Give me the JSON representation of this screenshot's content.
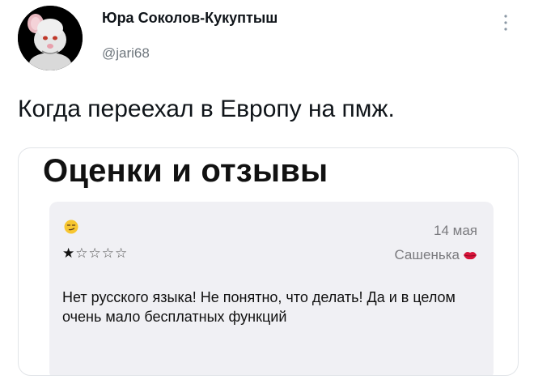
{
  "tweet": {
    "author_name": "Юра Соколов-Кукуптыш",
    "author_handle": "@jari68",
    "text": "Когда переехал в Европу на пмж."
  },
  "media": {
    "heading": "Оценки и отзывы",
    "review": {
      "emoji": "smirking-face-emoji",
      "date": "14 мая",
      "rating": 1,
      "max_rating": 5,
      "reviewer": "Сашенька",
      "reviewer_icon": "lips-icon",
      "text": "Нет русского языка! Не понятно, что делать! Да и в целом очень мало бесплатных функций"
    }
  },
  "colors": {
    "secondary_text": "#6e767d",
    "card_background": "#f0f0f4",
    "lips": "#d8143a"
  }
}
